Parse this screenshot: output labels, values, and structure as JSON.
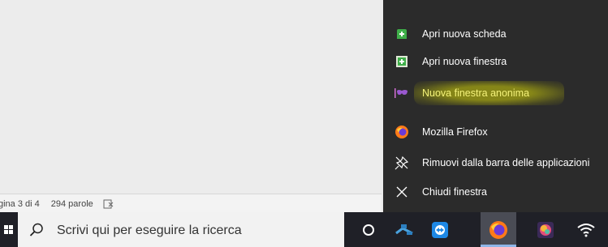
{
  "status_bar": {
    "page_info": "gina 3 di 4",
    "word_count": "294 parole",
    "proofing_icon": "proofing-icon"
  },
  "jumplist": {
    "items": [
      {
        "label": "Apri nuova scheda",
        "icon": "new-tab-icon"
      },
      {
        "label": "Apri nuova finestra",
        "icon": "new-window-icon"
      },
      {
        "label": "Nuova finestra anonima",
        "icon": "private-window-icon"
      },
      {
        "label": "Mozilla Firefox",
        "icon": "firefox-icon"
      },
      {
        "label": "Rimuovi dalla barra delle applicazioni",
        "icon": "unpin-icon"
      },
      {
        "label": "Chiudi finestra",
        "icon": "close-icon"
      }
    ],
    "highlight_color": "#9a9a14"
  },
  "taskbar": {
    "search_placeholder": "Scrivi qui per eseguire la ricerca",
    "icons": [
      "windows-start-icon",
      "search-icon",
      "cortana-icon",
      "network-app-icon",
      "teamviewer-icon",
      "firefox-icon",
      "colorful-app-icon",
      "wifi-icon"
    ]
  },
  "colors": {
    "taskbar_bg": "#1f2027",
    "jumplist_bg": "#2b2b2b",
    "accent_blue": "#1e88e5",
    "firefox_orange": "#ff7a18"
  }
}
